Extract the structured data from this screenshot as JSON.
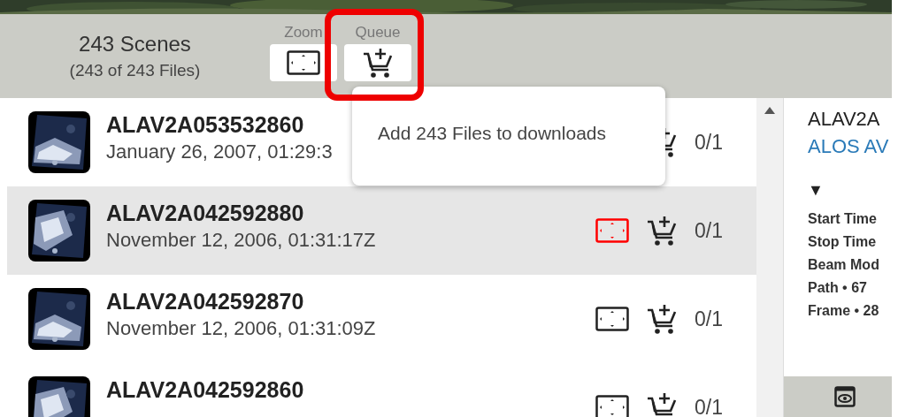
{
  "header": {
    "title": "243 Scenes",
    "subtitle": "(243 of 243 Files)",
    "tools": [
      {
        "label": "Zoom",
        "kind": "zoom",
        "highlighted": false
      },
      {
        "label": "Queue",
        "kind": "queue",
        "highlighted": true
      }
    ]
  },
  "popover": {
    "text": "Add 243 Files to downloads"
  },
  "scenes": [
    {
      "name": "ALAV2A053532860",
      "date": "January 26, 2007, 01:29:3",
      "count": "0/1",
      "selected": false
    },
    {
      "name": "ALAV2A042592880",
      "date": "November 12, 2006, 01:31:17Z",
      "count": "0/1",
      "selected": true
    },
    {
      "name": "ALAV2A042592870",
      "date": "November 12, 2006, 01:31:09Z",
      "count": "0/1",
      "selected": false
    },
    {
      "name": "ALAV2A042592860",
      "count": "0/1",
      "selected": false
    }
  ],
  "detail": {
    "title": "ALAV2A",
    "dataset": "ALOS AV",
    "toggle": "▼",
    "fields": [
      "Start Time",
      "Stop Time",
      "Beam Mod",
      "Path • 67",
      "Frame • 28"
    ]
  }
}
